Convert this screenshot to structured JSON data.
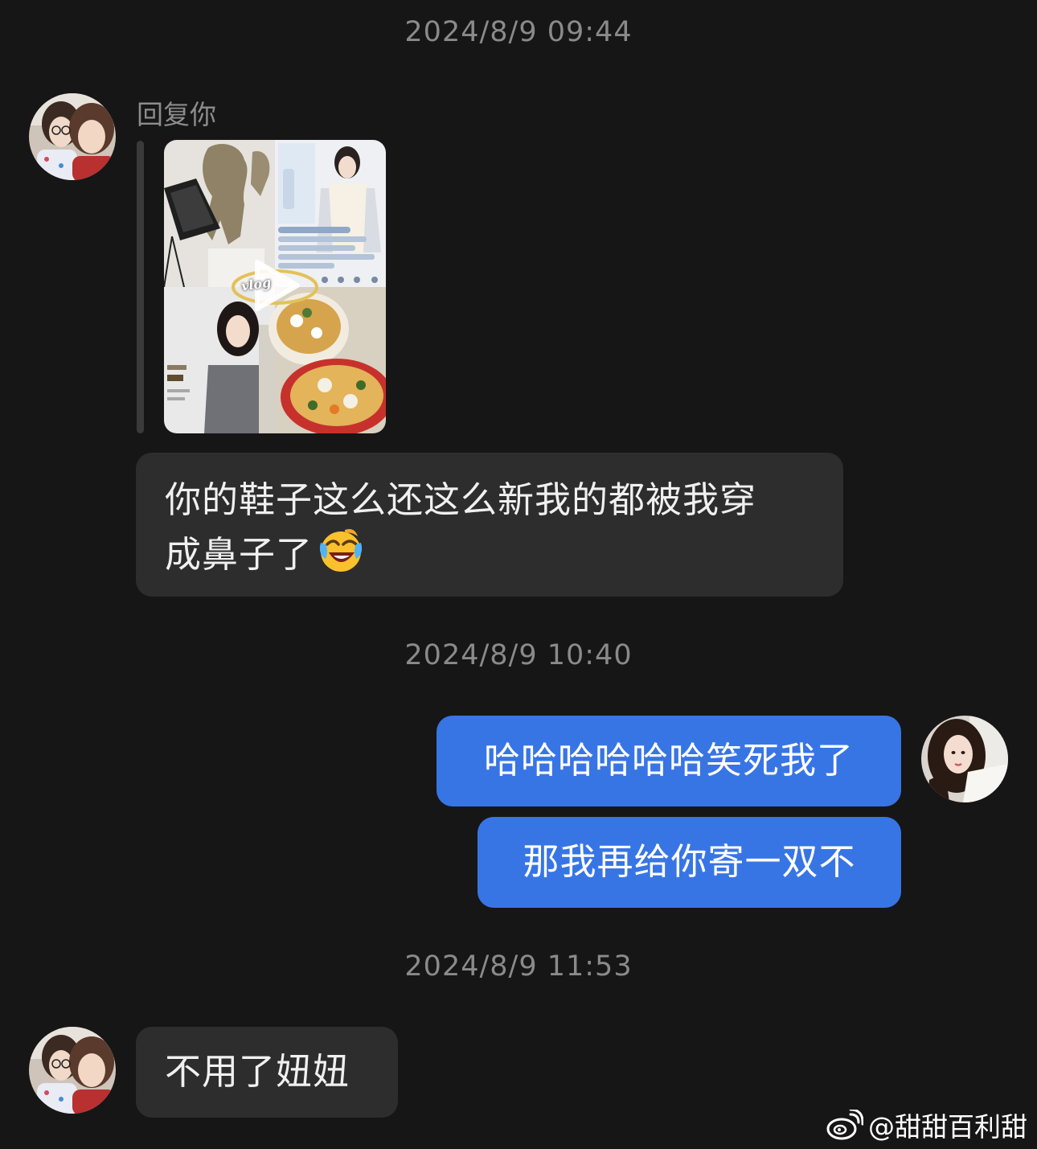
{
  "timestamps": {
    "t1": "2024/8/9 09:44",
    "t2": "2024/8/9 10:40",
    "t3": "2024/8/9 11:53"
  },
  "contact": {
    "avatar_icon": "contact-avatar-two-women-photo"
  },
  "me": {
    "avatar_icon": "my-avatar-woman-photo"
  },
  "reply": {
    "label": "回复你",
    "media_type": "video",
    "video_caption": "vlog",
    "play_icon": "play-icon"
  },
  "messages": [
    {
      "id": "m1",
      "side": "incoming",
      "text": "你的鞋子这么还这么新我的都被我穿成鼻子了",
      "line1": "你的鞋子这么还这么新我的都被我穿",
      "line2": "成鼻子了",
      "emoji": "laughing-crying-face-emoji"
    },
    {
      "id": "m2",
      "side": "outgoing",
      "text": "哈哈哈哈哈哈笑死我了"
    },
    {
      "id": "m3",
      "side": "outgoing",
      "text": "那我再给你寄一双不"
    },
    {
      "id": "m4",
      "side": "incoming",
      "text": "不用了妞妞"
    }
  ],
  "watermark": {
    "icon": "weibo-logo-icon",
    "text": "@甜甜百利甜"
  },
  "colors": {
    "background": "#161616",
    "incoming_bubble": "#2d2d2d",
    "outgoing_bubble": "#3875e4",
    "timestamp": "#8a8a8a"
  }
}
